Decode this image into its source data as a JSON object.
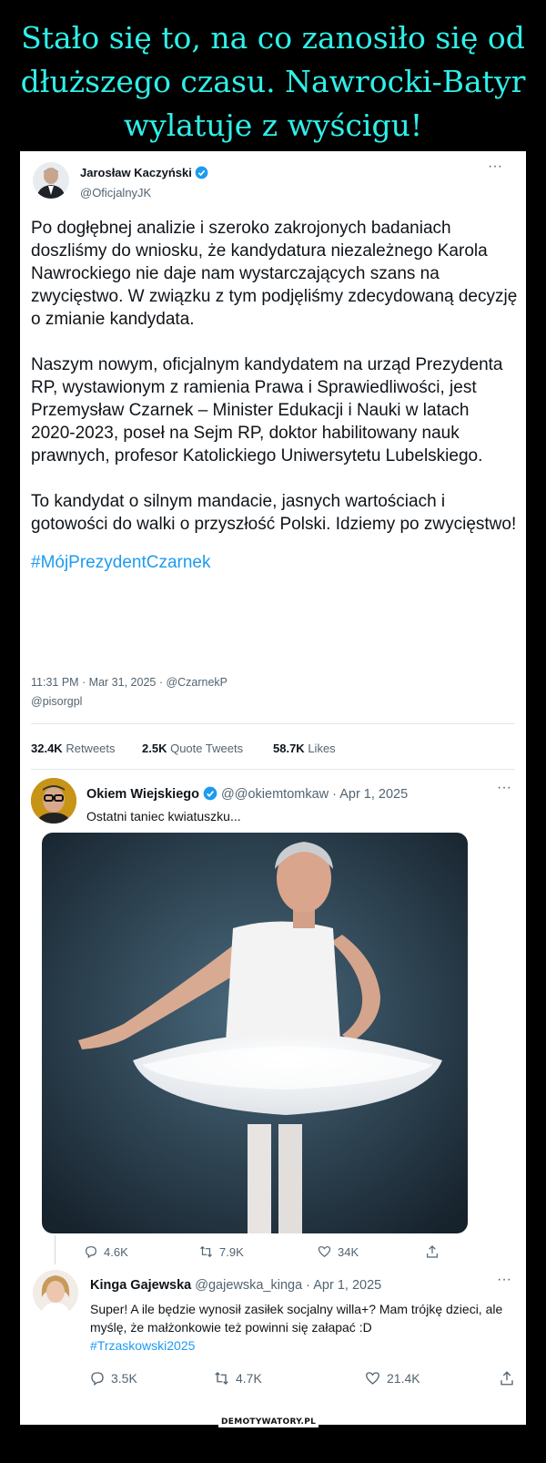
{
  "headline": {
    "line1": "Stało się to, na co zanosiło się od",
    "line2": "dłuższego czasu. Nawrocki-Batyr",
    "line3": "wylatuje z wyścigu!"
  },
  "main_tweet": {
    "author_name": "Jarosław Kaczyński",
    "author_handle": "@OficjalnyJK",
    "more": "···",
    "paragraph1": "Po dogłębnej analizie i szeroko zakrojonych badaniach doszliśmy do wniosku, że kandydatura niezależnego Karola Nawrockiego nie daje nam wystarczających szans na zwycięstwo. W związku z tym podjęliśmy zdecydowaną decyzję o zmianie kandydata.",
    "paragraph2": "Naszym nowym, oficjalnym kandydatem na urząd Prezydenta RP, wystawionym z ramienia Prawa i Sprawiedliwości, jest Przemysław Czarnek – Minister Edukacji i Nauki w latach 2020-2023, poseł na Sejm RP, doktor habilitowany nauk prawnych, profesor Katolickiego Uniwersytetu Lubelskiego.",
    "paragraph3": "To kandydat o silnym mandacie, jasnych wartościach i gotowości do walki o przyszłość Polski. Idziemy po zwycięstwo!",
    "hashtag": "#MójPrezydentCzarnek",
    "meta": "11:31 PM · Mar 31, 2025 · @CzarnekP",
    "meta2": "@pisorgpl",
    "retweets_count": "32.4K",
    "retweets_label": "Retweets",
    "quotes_count": "2.5K",
    "quotes_label": "Quote Tweets",
    "likes_count": "58.7K",
    "likes_label": "Likes"
  },
  "reply1": {
    "author_name": "Okiem Wiejskiego",
    "handle_date": "@@okiemtomkaw · Apr 1, 2025",
    "more": "···",
    "text": "Ostatni taniec kwiatuszku...",
    "replies": "4.6K",
    "retweets": "7.9K",
    "likes": "34K"
  },
  "reply2": {
    "author_name": "Kinga Gajewska",
    "handle_date": "@gajewska_kinga · Apr 1, 2025",
    "more": "···",
    "text": "Super! A ile będzie wynosił zasiłek socjalny willa+? Mam trójkę dzieci, ale myślę, że małżonkowie też powinni się załapać :D",
    "hashtag": "#Trzaskowski2025",
    "replies": "3.5K",
    "retweets": "4.7K",
    "likes": "21.4K"
  },
  "watermark": "DEMOTYWATORY.PL",
  "colors": {
    "headline": "#2ff0e8",
    "link": "#1d9bf0",
    "verified": "#1d9bf0",
    "muted": "#536471"
  }
}
